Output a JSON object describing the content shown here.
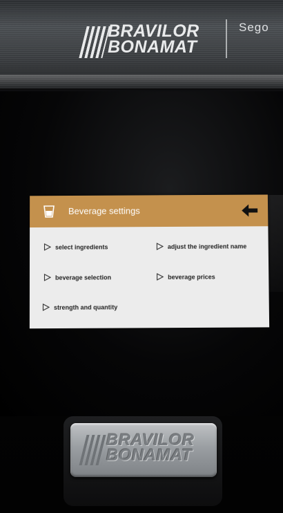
{
  "brand": {
    "line1": "BRAVILOR",
    "line2": "BONAMAT",
    "model": "Sego"
  },
  "screen": {
    "title": "Beverage settings",
    "title_icon": "cup-icon",
    "back_icon": "back-arrow-icon",
    "options": [
      {
        "label": "select ingredients"
      },
      {
        "label": "adjust the ingredient name"
      },
      {
        "label": "beverage selection"
      },
      {
        "label": "beverage prices"
      },
      {
        "label": "strength and quantity"
      }
    ]
  },
  "nameplate": {
    "line1": "BRAVILOR",
    "line2": "BONAMAT"
  },
  "colors": {
    "titlebar": "#c4914d",
    "screen_bg": "#ececec",
    "text": "#222222"
  }
}
